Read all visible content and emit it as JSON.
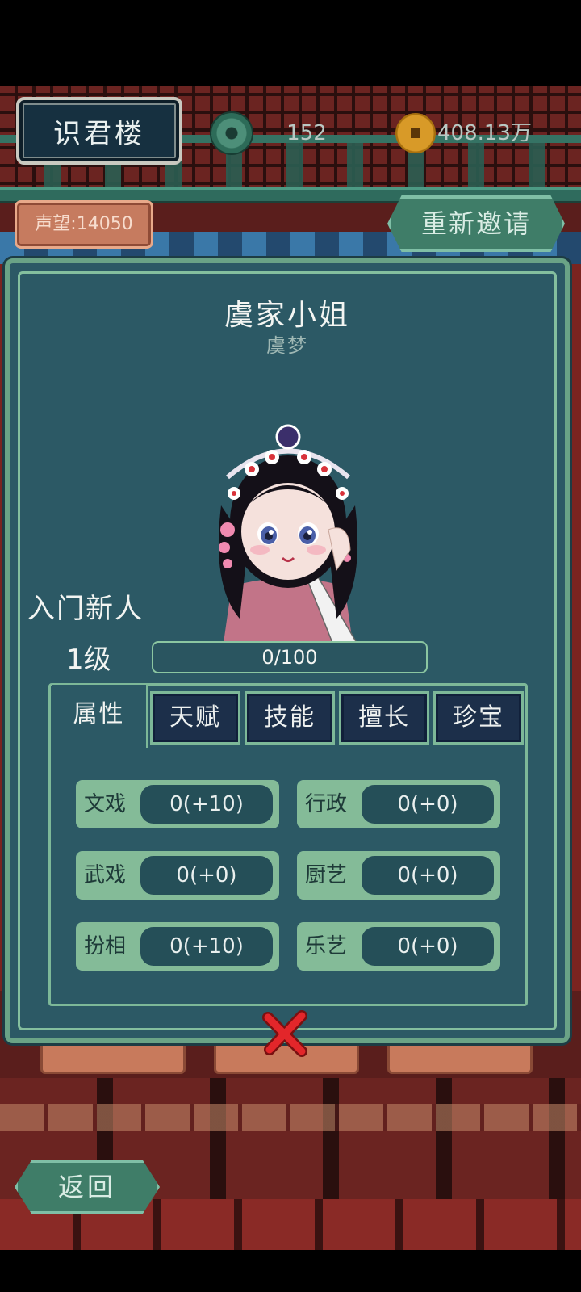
{
  "header": {
    "title": "识君楼",
    "jade_count": "152",
    "coin_count": "408.13万"
  },
  "fame_label": "声望:14050",
  "reinvite_label": "重新邀请",
  "back_label": "返回",
  "character": {
    "title": "虞家小姐",
    "name": "虞梦",
    "rank": "入门新人",
    "level": "1级",
    "xp": "0/100",
    "xp_fraction": 0
  },
  "tabs": [
    "属性",
    "天赋",
    "技能",
    "擅长",
    "珍宝"
  ],
  "active_tab": "属性",
  "attributes": [
    {
      "name": "文戏",
      "value": "0(+10)"
    },
    {
      "name": "行政",
      "value": "0(+0)"
    },
    {
      "name": "武戏",
      "value": "0(+0)"
    },
    {
      "name": "厨艺",
      "value": "0(+0)"
    },
    {
      "name": "扮相",
      "value": "0(+10)"
    },
    {
      "name": "乐艺",
      "value": "0(+0)"
    }
  ],
  "colors": {
    "dialog_bg": "#2c5965",
    "accent_green": "#6aa386",
    "tab_dark": "#1c2f4a",
    "close_red": "#e3262a"
  },
  "icons": {
    "jade": "jade-disc-icon",
    "coin": "copper-coin-icon",
    "close": "close-icon"
  }
}
